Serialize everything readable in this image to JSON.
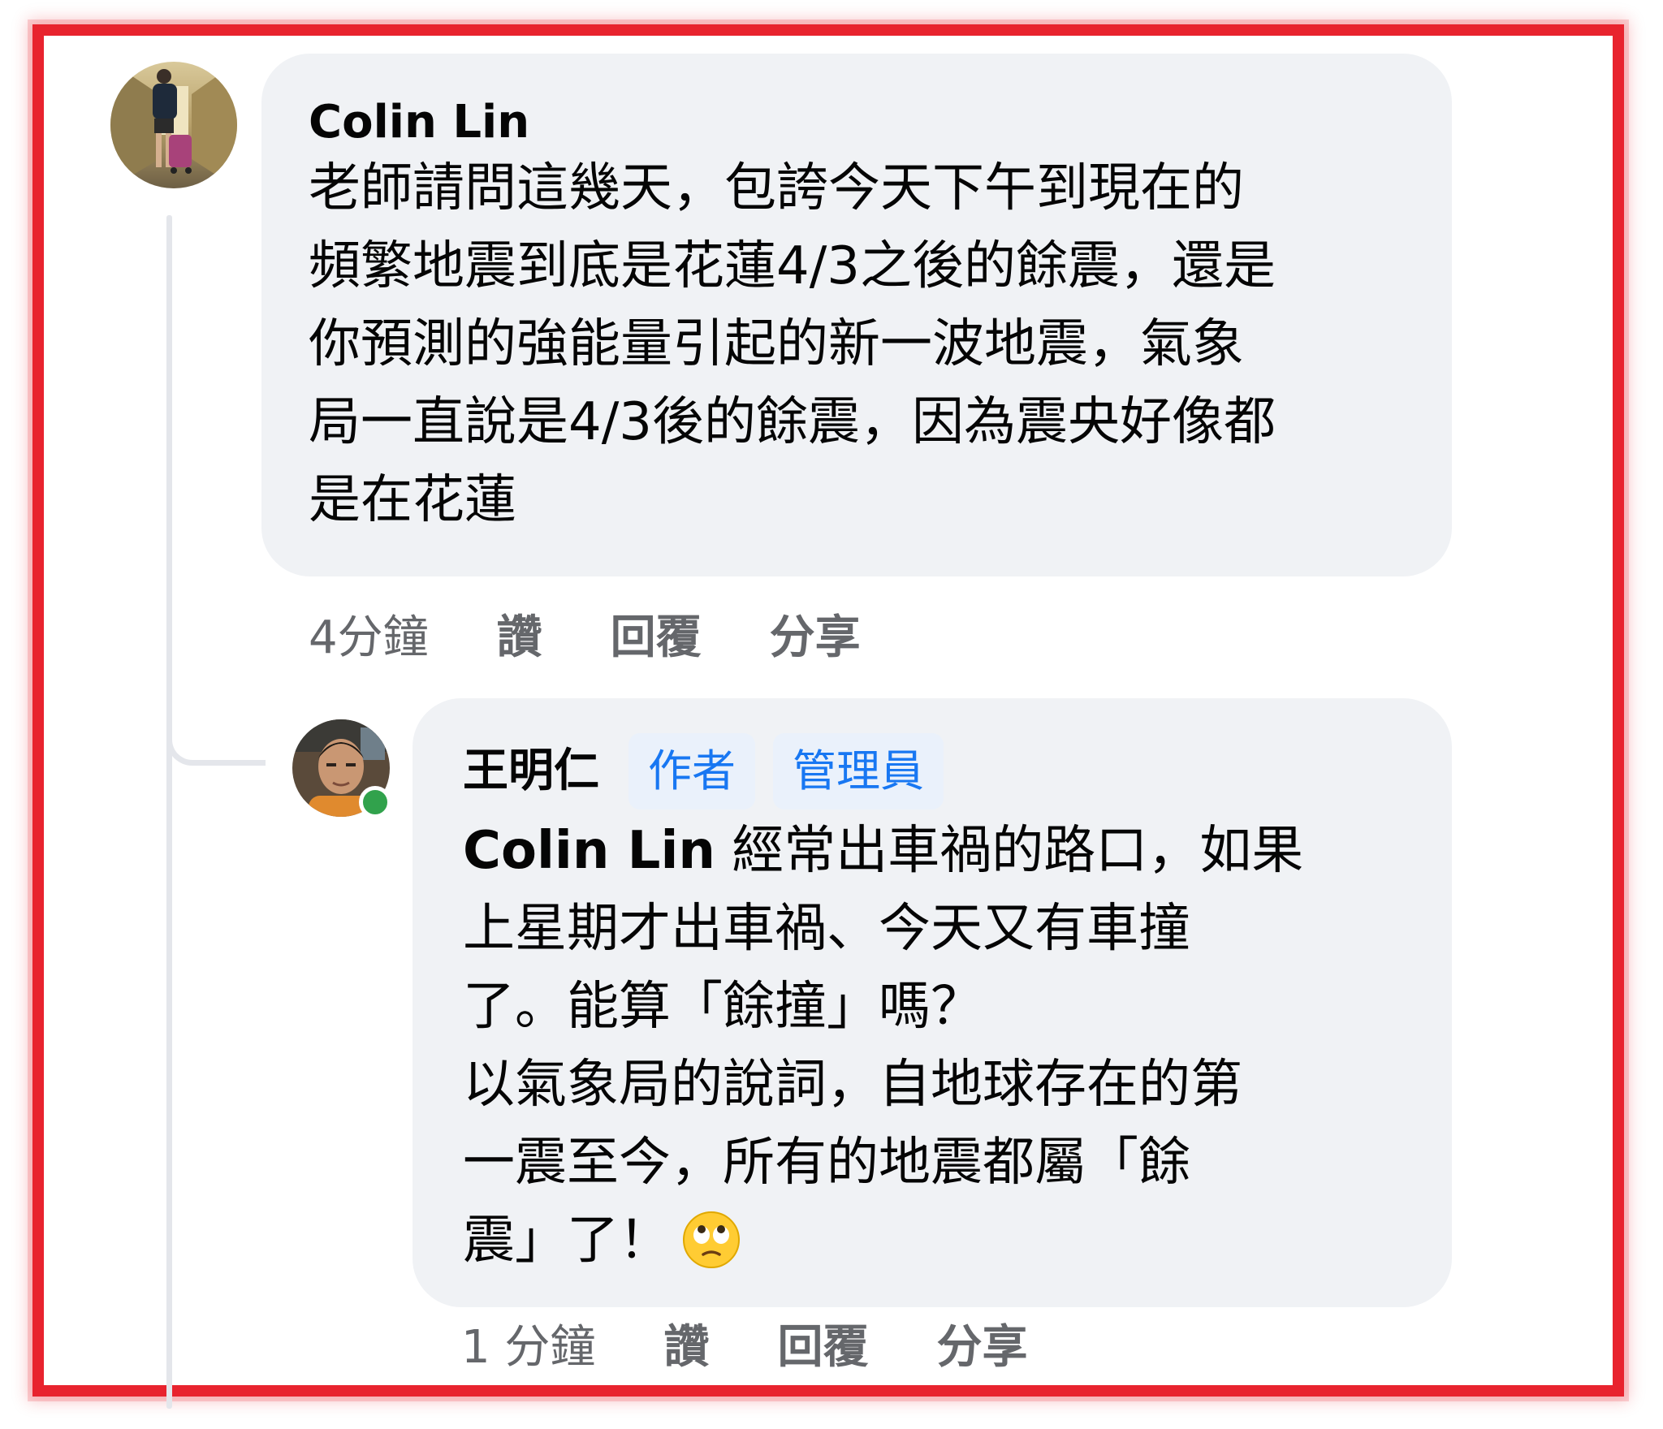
{
  "comment": {
    "author": "Colin Lin",
    "text": "老師請問這幾天，包誇今天下午到現在的\n頻繁地震到底是花蓮4/3之後的餘震，還是\n你預測的強能量引起的新一波地震，氣象\n局一直說是4/3後的餘震，因為震央好像都\n是在花蓮",
    "time": "4分鐘",
    "like_label": "讚",
    "reply_label": "回覆",
    "share_label": "分享"
  },
  "reply": {
    "author": "王明仁",
    "badges": [
      "作者",
      "管理員"
    ],
    "mention": "Colin Lin",
    "text_line1": " 經常出車禍的路口，如果",
    "text_rest": "上星期才出車禍、今天又有車撞\n了。能算「餘撞」嗎？\n以氣象局的說詞，自地球存在的第\n一震至今，所有的地震都屬「餘\n震」了！",
    "emoji": "face-with-rolling-eyes-icon",
    "time": "1 分鐘",
    "like_label": "讚",
    "reply_label": "回覆",
    "share_label": "分享"
  },
  "colors": {
    "frame": "#e8232e",
    "bubble": "#f0f2f5",
    "badge_text": "#1877f2",
    "meta_text": "#65676b",
    "online": "#31a24c"
  }
}
